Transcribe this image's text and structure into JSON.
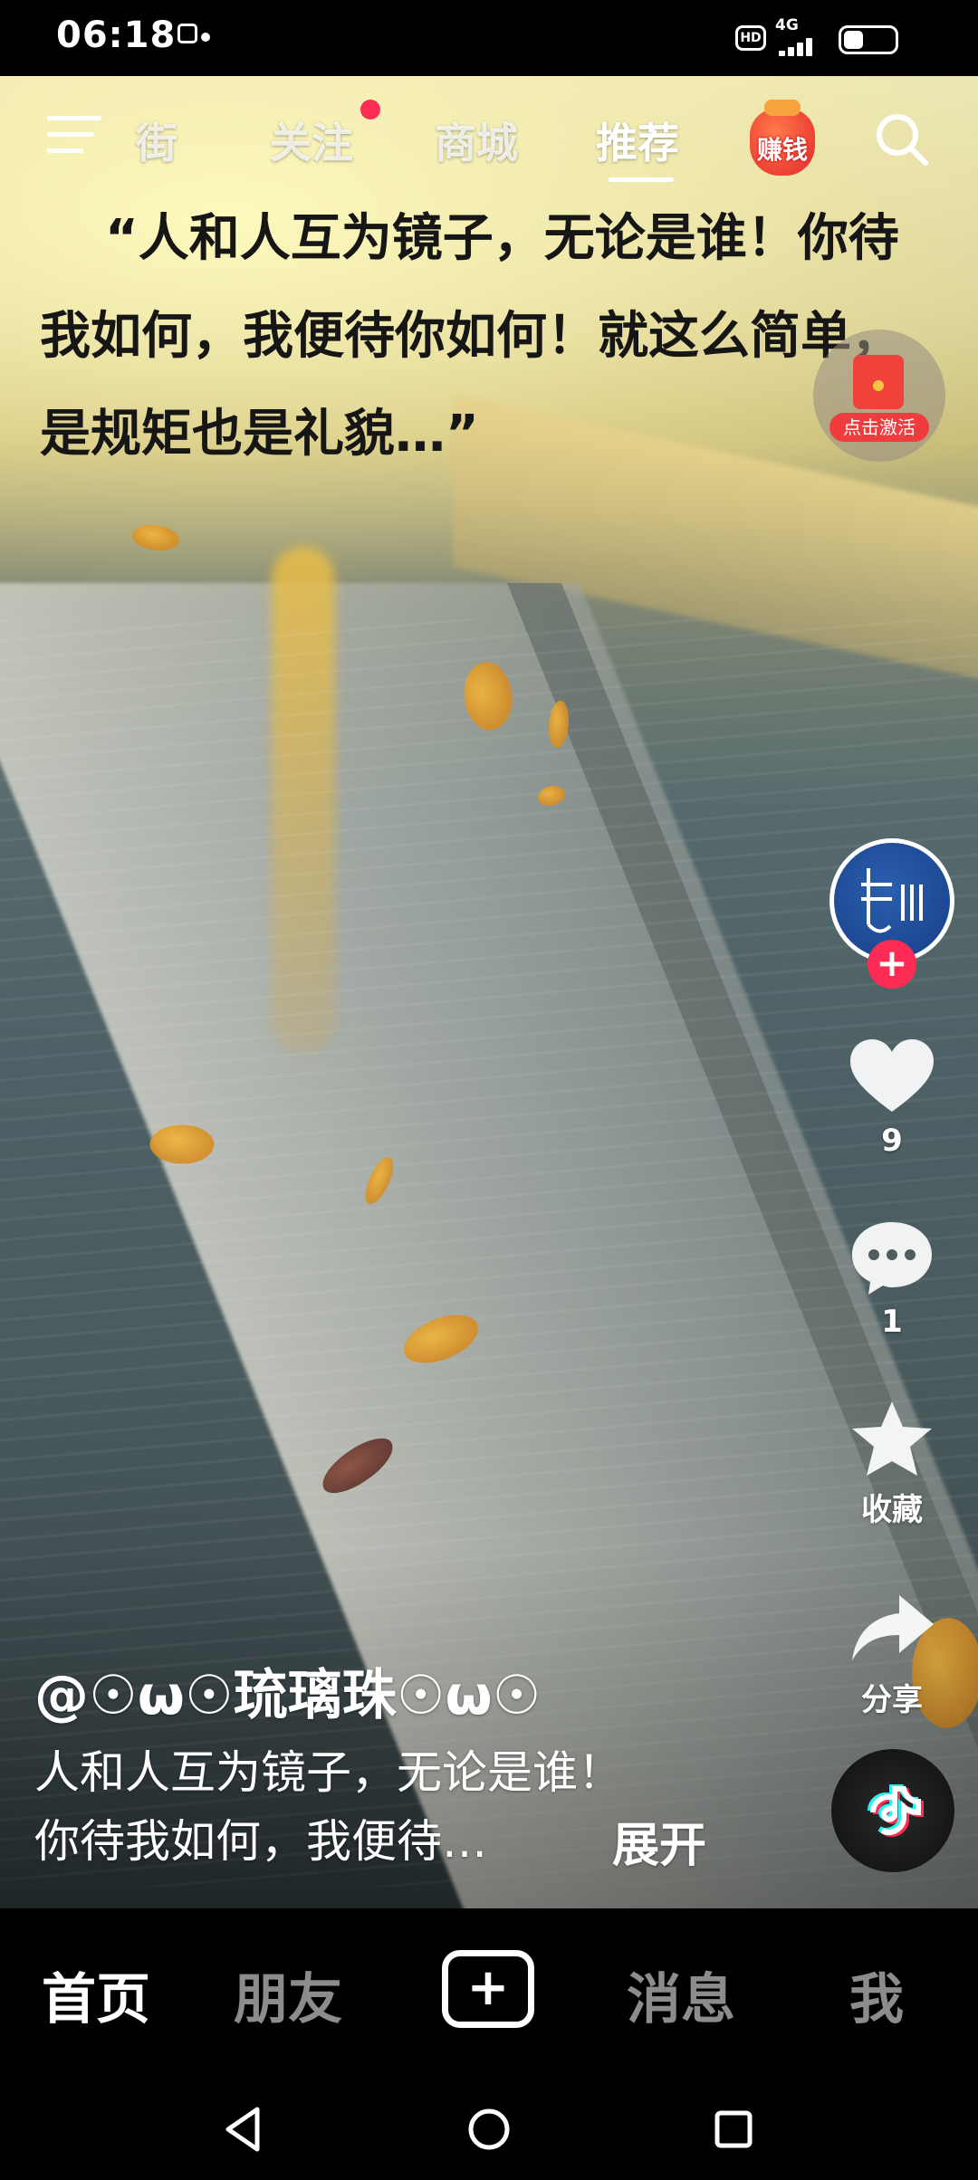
{
  "status_bar": {
    "time": "06:18",
    "hd_label": "HD",
    "network_label": "4G"
  },
  "top_nav": {
    "tabs": [
      {
        "label": "街"
      },
      {
        "label": "关注"
      },
      {
        "label": "商城"
      },
      {
        "label": "推荐"
      }
    ],
    "active_tab": "推荐",
    "earn_label": "赚钱"
  },
  "video_overlay": {
    "quote": "“人和人互为镜子，无论是谁！你待我如何，我便待你如何！就这么简单，是规矩也是礼貌…”"
  },
  "red_packet": {
    "label": "点击激活"
  },
  "actions": {
    "likes": "9",
    "comments": "1",
    "favorite_label": "收藏",
    "share_label": "分享"
  },
  "caption": {
    "username": "@☉ω☉琉璃珠☉ω☉",
    "line1": "人和人互为镜子，无论是谁！",
    "line2": "你待我如何，我便待…",
    "expand_label": "展开"
  },
  "bottom_nav": {
    "items": [
      {
        "label": "首页"
      },
      {
        "label": "朋友"
      },
      {
        "label": "+"
      },
      {
        "label": "消息"
      },
      {
        "label": "我"
      }
    ]
  },
  "colors": {
    "accent_red": "#fe2c55",
    "background": "#000000",
    "text_primary": "#ffffff"
  }
}
